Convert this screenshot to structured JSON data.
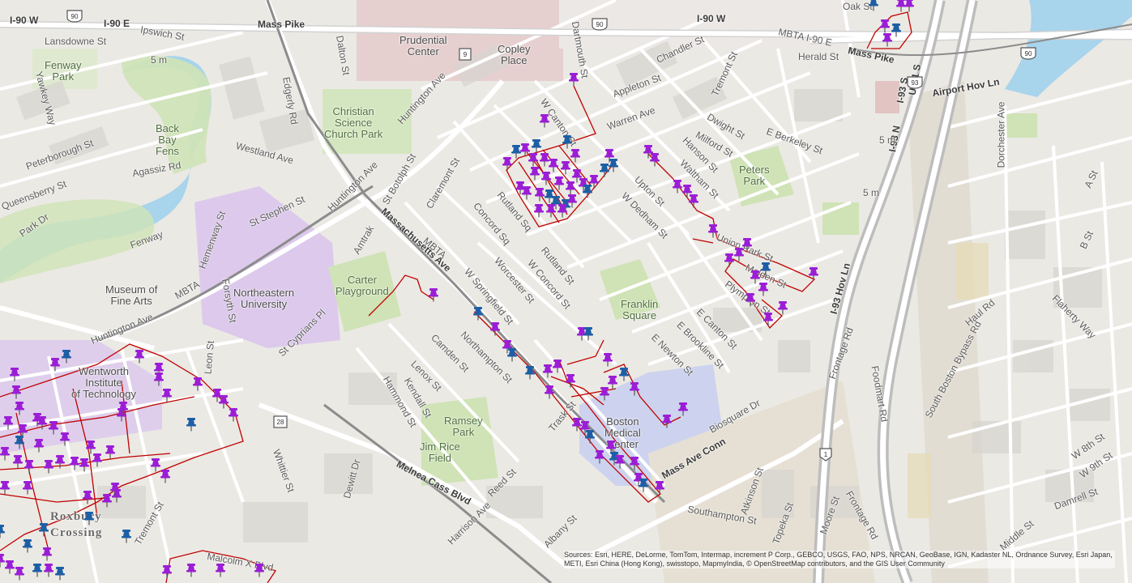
{
  "map": {
    "attribution": "Sources: Esri, HERE, DeLorme, TomTom, Intermap, increment P Corp., GEBCO, USGS, FAO, NPS, NRCAN, GeoBase, IGN, Kadaster NL, Ordnance Survey, Esri Japan, METI, Esri China (Hong Kong), swisstopo, MapmyIndia, © OpenStreetMap contributors, and the GIS User Community",
    "colors": {
      "route": "#c00000",
      "pin_purple": "#9b1ed6",
      "pin_blue": "#1d5fa6",
      "park": "#cfe3b6",
      "water": "#a8d4ec",
      "campus": "#dcc9ec",
      "medical": "#cdd3ee"
    },
    "labels": {
      "prudential": "Prudential\nCenter",
      "copley": "Copley\nPlace",
      "christian_science": "Christian\nScience\nChurch Park",
      "fenway_park": "Fenway\nPark",
      "back_bay_fens": "Back\nBay\nFens",
      "museum": "Museum of\nFine Arts",
      "northeastern": "Northeastern\nUniversity",
      "carter": "Carter\nPlayground",
      "wentworth": "Wentworth\nInstitute\nof Technology",
      "franklin": "Franklin\nSquare",
      "bmc": "Boston\nMedical\nCenter",
      "ramsey": "Ramsey\nPark",
      "jim_rice": "Jim Rice\nField",
      "peters": "Peters\nPark",
      "roxbury": "Roxbury\nCrossing",
      "mass_pike": "Mass Pike",
      "i90w": "I-90 W",
      "i90e": "I-90 E",
      "i90w_2": "I-90 W",
      "mbta_i90e": "MBTA I-90 E",
      "mass_pike_2": "Mass Pike",
      "huntington_ave": "Huntington Ave",
      "huntington_ave_2": "Huntington Ave",
      "huntington_ave_3": "Huntington Ave",
      "mass_ave": "Massachusetts Ave",
      "mass_ave_conn": "Mass Ave Conn",
      "melnea": "Melnea Cass Blvd",
      "i93n": "I-93 N",
      "i93s": "I-93 S",
      "us1s": "US-1 S",
      "i93hov": "I-93 Hov Ln",
      "airport_hov": "Airport Hov Ln",
      "herald": "Herald St",
      "chandler": "Chandler St",
      "appleton": "Appleton St",
      "warren": "Warren Ave",
      "dwight": "Dwight St",
      "milford": "Milford St",
      "hanson": "Hanson St",
      "e_berkeley": "E Berkeley St",
      "tremont": "Tremont St",
      "waltham": "Waltham St",
      "upton": "Upton St",
      "w_dedham": "W Dedham St",
      "union_park": "Union Park St",
      "malden": "Malden St",
      "plympton": "Plympton St",
      "e_canton": "E Canton St",
      "e_brookline": "E Brookline St",
      "e_newton": "E Newton St",
      "biosquare": "Biosquare Dr",
      "frontage": "Frontage Rd",
      "frontage_2": "Frontage Rd",
      "foodmart": "Foodmart Rd",
      "south_boston_bypass": "South Boston Bypass Rd",
      "haul": "Haul Rd",
      "dorchester": "Dorchester Ave",
      "flaherty": "Flaherty Way",
      "w8": "W 8th St",
      "w9": "W 9th St",
      "damrell": "Damrell St",
      "middle": "Middle St",
      "a_st": "A St",
      "b_st": "B St",
      "southampton": "Southampton St",
      "atkinson": "Atkinson St",
      "topeka": "Topeka St",
      "moore": "Moore St",
      "albany": "Albany St",
      "harrison": "Harrison Ave",
      "reed": "Reed St",
      "trask": "Trask St",
      "northampton": "Northampton St",
      "camden": "Camden St",
      "lenox": "Lenox St",
      "kendall": "Kendall St",
      "hammond": "Hammond St",
      "w_springfield": "W Springfield St",
      "worcester": "Worcester St",
      "concord_sq": "Concord Sq",
      "rutland_sq": "Rutland Sq",
      "rutland_st": "Rutland St",
      "w_concord": "W Concord St",
      "claremont": "Claremont St",
      "st_botolph": "St Botolph St",
      "amtrak": "Amtrak",
      "st_cyprians": "St Cyprians Pl",
      "dewitt": "Dewitt Dr",
      "whittier": "Whittier St",
      "st_stephen": "St Stephen St",
      "westland": "Westland Ave",
      "agassiz": "Agassiz Rd",
      "peterborough": "Peterborough St",
      "queensberry": "Queensberry St",
      "park_dr": "Park Dr",
      "fenway": "Fenway",
      "hemenway": "Hemenway St",
      "forsyth": "Forsyth St",
      "leon": "Leon St",
      "yawkey": "Yawkey Way",
      "lansdowne": "Lansdowne St",
      "ipswich": "Ipswich St",
      "dalton": "Dalton St",
      "edgerly": "Edgerly Rd",
      "dartmouth": "Dartmouth St",
      "w_canton": "W Canton St",
      "oak": "Oak St",
      "malcolm_x": "Malcolm X Blvd",
      "tremont_2": "Tremont St",
      "mbta": "MBTA",
      "mbta_2": "MBTA",
      "five_m": "5 m",
      "five_m_2": "5 m",
      "five_m_3": "5 m",
      "shield_90": "90",
      "shield_90b": "90",
      "shield_90c": "90",
      "shield_9": "9",
      "shield_93": "93",
      "shield_1": "1",
      "shield_28": "28"
    }
  }
}
